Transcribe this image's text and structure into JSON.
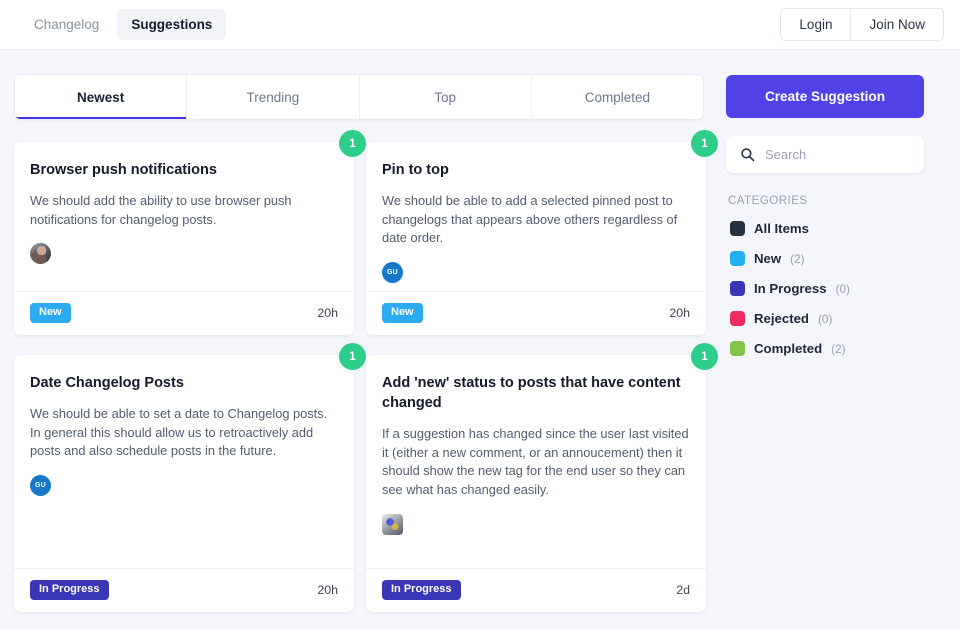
{
  "header": {
    "nav": [
      {
        "label": "Changelog",
        "active": false
      },
      {
        "label": "Suggestions",
        "active": true
      }
    ],
    "auth": [
      {
        "label": "Login"
      },
      {
        "label": "Join Now"
      }
    ]
  },
  "tabs": [
    {
      "label": "Newest",
      "active": true
    },
    {
      "label": "Trending",
      "active": false
    },
    {
      "label": "Top",
      "active": false
    },
    {
      "label": "Completed",
      "active": false
    }
  ],
  "cards": [
    {
      "title": "Browser push notifications",
      "description": "We should add the ability to use browser push notifications for changelog posts.",
      "avatar_type": "photo",
      "avatar_text": "",
      "status": "New",
      "status_color": "#2dabf0",
      "time": "20h",
      "badge_count": "1",
      "badge_color": "#2dce89"
    },
    {
      "title": "Pin to top",
      "description": "We should be able to add a selected pinned post to changelogs that appears above others regardless of date order.",
      "avatar_type": "initials",
      "avatar_text": "GU",
      "status": "New",
      "status_color": "#2dabf0",
      "time": "20h",
      "badge_count": "1",
      "badge_color": "#2dce89"
    },
    {
      "title": "Date Changelog Posts",
      "description": "We should be able to set a date to Changelog posts. In general this should allow us to retroactively add posts and also schedule posts in the future.",
      "avatar_type": "initials",
      "avatar_text": "GU",
      "status": "In Progress",
      "status_color": "#3b36b5",
      "time": "20h",
      "badge_count": "1",
      "badge_color": "#2dce89"
    },
    {
      "title": "Add 'new' status to posts that have content changed",
      "description": "If a suggestion has changed since the user last visited it (either a new comment, or an annoucement) then it should show the new tag for the end user so they can see what has changed easily.",
      "avatar_type": "image",
      "avatar_text": "",
      "status": "In Progress",
      "status_color": "#3b36b5",
      "time": "2d",
      "badge_count": "1",
      "badge_color": "#2dce89"
    }
  ],
  "sidebar": {
    "create_button": "Create Suggestion",
    "search": {
      "placeholder": "Search",
      "value": "",
      "icon": "search-icon"
    },
    "categories_heading": "CATEGORIES",
    "categories": [
      {
        "label": "All Items",
        "count": "",
        "color": "#27303f"
      },
      {
        "label": "New",
        "count": "(2)",
        "color": "#22b0f0"
      },
      {
        "label": "In Progress",
        "count": "(0)",
        "color": "#3b36b5"
      },
      {
        "label": "Rejected",
        "count": "(0)",
        "color": "#ef2b63"
      },
      {
        "label": "Completed",
        "count": "(2)",
        "color": "#85c44b"
      }
    ]
  }
}
